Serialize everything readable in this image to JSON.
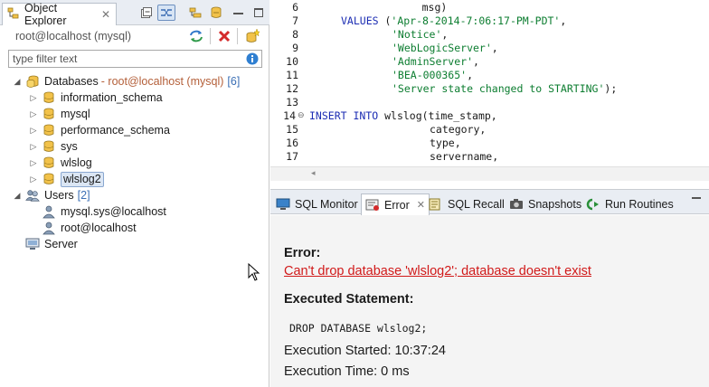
{
  "object_explorer": {
    "tab_label": "Object Explorer",
    "tab_close": "✕",
    "connection_label": "root@localhost (mysql)",
    "filter_placeholder": "type filter text",
    "tree": {
      "databases": {
        "label": "Databases",
        "connection": "- root@localhost (mysql)",
        "count": "[6]"
      },
      "schemas": [
        "information_schema",
        "mysql",
        "performance_schema",
        "sys",
        "wlslog",
        "wlslog2"
      ],
      "users": {
        "label": "Users",
        "count": "[2]"
      },
      "user_items": [
        "mysql.sys@localhost",
        "root@localhost"
      ],
      "server": {
        "label": "Server"
      }
    }
  },
  "editor": {
    "line_numbers": [
      "6",
      "7",
      "8",
      "9",
      "10",
      "11",
      "12",
      "13",
      "14",
      "15",
      "16",
      "17"
    ],
    "lines": {
      "l6": "                  msg)",
      "l7_kw": "VALUES",
      "l7_rest": " (",
      "l7_str": "'Apr-8-2014-7:06:17-PM-PDT'",
      "l7_end": ",",
      "l8_str": "'Notice'",
      "l9_str": "'WebLogicServer'",
      "l10_str": "'AdminServer'",
      "l11_str": "'BEA-000365'",
      "l12_str": "'Server state changed to STARTING'",
      "l12_end": ");",
      "l14_kw": "INSERT INTO",
      "l14_rest": " wlslog(time_stamp,",
      "l15": "category,",
      "l16": "type,",
      "l17": "servername,",
      "comma": ","
    }
  },
  "panel": {
    "tabs": [
      "SQL Monitor",
      "Error",
      "SQL Recall",
      "Snapshots",
      "Run Routines"
    ],
    "error_tab_close": "✕",
    "error_heading": "Error:",
    "error_message": "Can't drop database 'wlslog2'; database doesn't exist",
    "executed_heading": "Executed Statement:",
    "statement": "DROP DATABASE wlslog2;",
    "execution_started": "Execution Started: 10:37:24",
    "execution_time": "Execution Time: 0 ms"
  },
  "icons": {
    "object_explorer": "object-explorer-icon",
    "collapse_all": "collapse-all-icon",
    "link_editor": "link-editor-icon",
    "filter": "filter-icon",
    "view_menu": "view-menu-icon",
    "minimize": "minimize-icon",
    "maximize": "maximize-icon",
    "refresh": "refresh-icon",
    "disconnect": "disconnect-icon",
    "new_connection": "new-connection-icon",
    "info": "info-icon",
    "database": "database-icon",
    "users": "users-icon",
    "user": "user-icon",
    "server": "server-icon"
  },
  "colors": {
    "accent_blue": "#3b6fb5",
    "error_red": "#d11a1a",
    "keyword": "#1c2db3",
    "string": "#0c7d30",
    "db_yellow": "#e8b730"
  }
}
